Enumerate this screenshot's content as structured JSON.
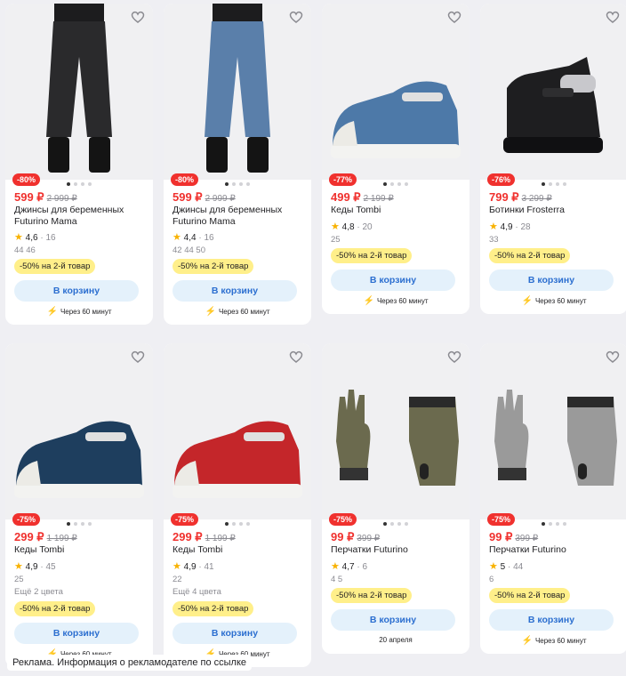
{
  "products": [
    {
      "discount": "-80%",
      "price": "599 ₽",
      "old_price": "2 999 ₽",
      "name": "Джинсы для беременных Futurino Mama",
      "rating": "4,6",
      "reviews": "16",
      "sizes": "44  46",
      "colors": "",
      "promo": "-50% на 2-й товар",
      "cart": "В корзину",
      "delivery": "Через 60 минут",
      "icon": "pants-icon",
      "color": "#2a2a2c"
    },
    {
      "discount": "-80%",
      "price": "599 ₽",
      "old_price": "2 999 ₽",
      "name": "Джинсы для беременных Futurino Mama",
      "rating": "4,4",
      "reviews": "16",
      "sizes": "42  44  50",
      "colors": "",
      "promo": "-50% на 2-й товар",
      "cart": "В корзину",
      "delivery": "Через 60 минут",
      "icon": "pants-icon",
      "color": "#5a7faa"
    },
    {
      "discount": "-77%",
      "price": "499 ₽",
      "old_price": "2 199 ₽",
      "name": "Кеды Tombi",
      "rating": "4,8",
      "reviews": "20",
      "sizes": "25",
      "colors": "",
      "promo": "-50% на 2-й товар",
      "cart": "В корзину",
      "delivery": "Через 60 минут",
      "icon": "sneaker-icon",
      "color": "#4d79a8"
    },
    {
      "discount": "-76%",
      "price": "799 ₽",
      "old_price": "3 299 ₽",
      "name": "Ботинки Frosterra",
      "rating": "4,9",
      "reviews": "28",
      "sizes": "33",
      "colors": "",
      "promo": "-50% на 2-й товар",
      "cart": "В корзину",
      "delivery": "Через 60 минут",
      "icon": "boot-icon",
      "color": "#1e1e20"
    },
    {
      "discount": "-75%",
      "price": "299 ₽",
      "old_price": "1 199 ₽",
      "name": "Кеды Tombi",
      "rating": "4,9",
      "reviews": "45",
      "sizes": "25",
      "colors": "Ещё 2 цвета",
      "promo": "-50% на 2-й товар",
      "cart": "В корзину",
      "delivery": "Через 60 минут",
      "icon": "sneaker-icon",
      "color": "#1e3e5e"
    },
    {
      "discount": "-75%",
      "price": "299 ₽",
      "old_price": "1 199 ₽",
      "name": "Кеды Tombi",
      "rating": "4,9",
      "reviews": "41",
      "sizes": "22",
      "colors": "Ещё 4 цвета",
      "promo": "-50% на 2-й товар",
      "cart": "В корзину",
      "delivery": "Через 60 минут",
      "icon": "sneaker-icon",
      "color": "#c4262a"
    },
    {
      "discount": "-75%",
      "price": "99 ₽",
      "old_price": "399 ₽",
      "name": "Перчатки Futurino",
      "rating": "4,7",
      "reviews": "6",
      "sizes": "4  5",
      "colors": "",
      "promo": "-50% на 2-й товар",
      "cart": "В корзину",
      "delivery": "20 апреля",
      "icon": "gloves-icon",
      "color": "#6b6a4e"
    },
    {
      "discount": "-75%",
      "price": "99 ₽",
      "old_price": "399 ₽",
      "name": "Перчатки Futurino",
      "rating": "5",
      "reviews": "44",
      "sizes": "6",
      "colors": "",
      "promo": "-50% на 2-й товар",
      "cart": "В корзину",
      "delivery": "Через 60 минут",
      "icon": "gloves-icon",
      "color": "#9a9a9a"
    }
  ],
  "ad_notice": "Реклама. Информация о рекламодателе по ссылке"
}
